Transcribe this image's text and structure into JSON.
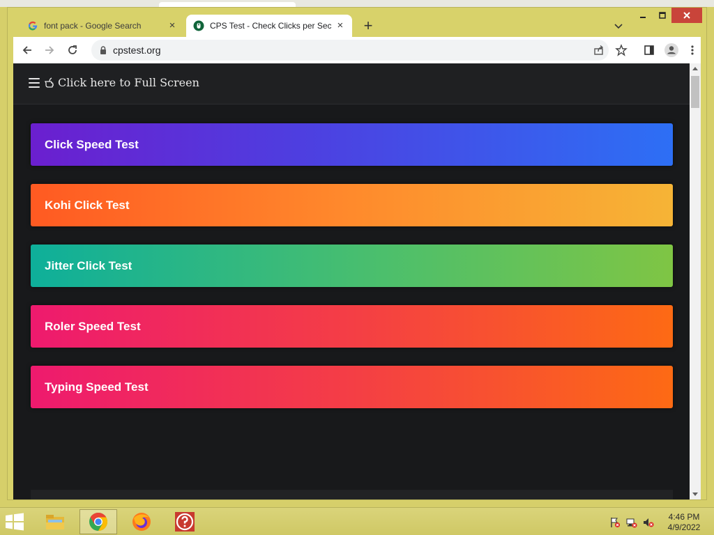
{
  "browser": {
    "tabs": [
      {
        "title": "font pack - Google Search",
        "favicon": "google-g-icon",
        "active": false
      },
      {
        "title": "CPS Test - Check Clicks per Second",
        "favicon": "cpstest-icon",
        "active": true
      }
    ],
    "address": "cpstest.org",
    "new_tab_symbol": "+",
    "close_symbol": "×"
  },
  "site": {
    "header": {
      "menu_icon": "hamburger-icon",
      "fullscreen_text": "Click here to Full Screen",
      "fullscreen_icon": "pointing-hand-icon"
    },
    "tests": [
      {
        "label": "Click Speed Test"
      },
      {
        "label": "Kohi Click Test"
      },
      {
        "label": "Jitter Click Test"
      },
      {
        "label": "Roler Speed Test"
      },
      {
        "label": "Typing Speed Test"
      }
    ]
  },
  "taskbar": {
    "apps": [
      "file-explorer-icon",
      "chrome-icon",
      "firefox-icon",
      "help-icon"
    ],
    "clock": {
      "time": "4:46 PM",
      "date": "4/9/2022"
    }
  },
  "colors": {
    "window_frame": "#d8d26a",
    "page_bg": "#18191b",
    "close_button": "#c9443a"
  }
}
